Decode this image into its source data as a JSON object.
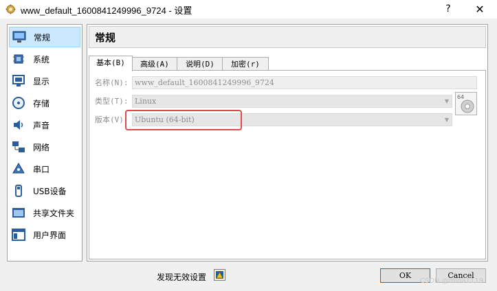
{
  "window": {
    "title": "www_default_1600841249996_9724 - 设置",
    "help_label": "?",
    "close_label": "✕"
  },
  "sidebar": {
    "items": [
      {
        "label": "常规",
        "icon": "monitor-general-icon"
      },
      {
        "label": "系统",
        "icon": "chip-icon"
      },
      {
        "label": "显示",
        "icon": "display-icon"
      },
      {
        "label": "存储",
        "icon": "storage-disk-icon"
      },
      {
        "label": "声音",
        "icon": "speaker-icon"
      },
      {
        "label": "网络",
        "icon": "network-icon"
      },
      {
        "label": "串口",
        "icon": "serial-port-icon"
      },
      {
        "label": "USB设备",
        "icon": "usb-icon"
      },
      {
        "label": "共享文件夹",
        "icon": "shared-folder-icon"
      },
      {
        "label": "用户界面",
        "icon": "user-interface-icon"
      }
    ]
  },
  "main": {
    "header_title": "常规",
    "tabs": [
      {
        "label": "基本(B)"
      },
      {
        "label": "高级(A)"
      },
      {
        "label": "说明(D)"
      },
      {
        "label": "加密(r)"
      }
    ],
    "form": {
      "name_label": "名称(N):",
      "name_value": "www_default_1600841249996_9724",
      "type_label": "类型(T):",
      "type_value": "Linux",
      "version_label": "版本(V):",
      "version_value": "Ubuntu (64-bit)",
      "os_badge": "64"
    }
  },
  "footer": {
    "invalid_settings_label": "发现无效设置",
    "ok_label": "OK",
    "cancel_label": "Cancel",
    "watermark": "CSDN @mina1119"
  },
  "colors": {
    "highlight": "#e0474c",
    "active_item": "#cce8ff",
    "ok_border": "#0078d7"
  }
}
